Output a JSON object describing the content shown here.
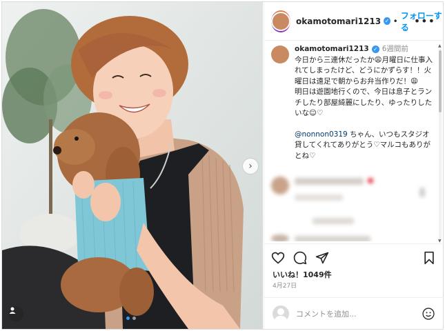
{
  "post": {
    "username": "okamotomari1213",
    "follow_label": "フォローする",
    "more_label": "•••",
    "separator": "•"
  },
  "caption": {
    "username": "okamotomari1213",
    "time": "6週間前",
    "line1": "今日から三連休だったか😩月曜日に仕事入れてしまったけど、どうにかずらす！！火曜日は遠足で朝からお弁当作りだ！😩",
    "line2": "明日は遊園地行くので、今日は息子とランチしたり部屋綺麗にしたり、ゆったりしたいな☺︎♡",
    "mention": "@nonnon0319",
    "line3": " ちゃん、いつもスタジオ貸してくれてありがとう♡マルコもありがとね♡"
  },
  "likes": "いいね！1049件",
  "date": "4月27日",
  "comment_placeholder": "コメントを追加...",
  "icons": {
    "heart": "heart-icon",
    "comment": "comment-icon",
    "share": "share-icon",
    "save": "bookmark-icon",
    "emoji": "emoji-icon",
    "next": "chevron-right-icon",
    "tag": "user-tag-icon"
  },
  "colors": {
    "accent": "#0095f6",
    "verified": "#3897f0",
    "text": "#262626",
    "muted": "#8e8e8e"
  }
}
